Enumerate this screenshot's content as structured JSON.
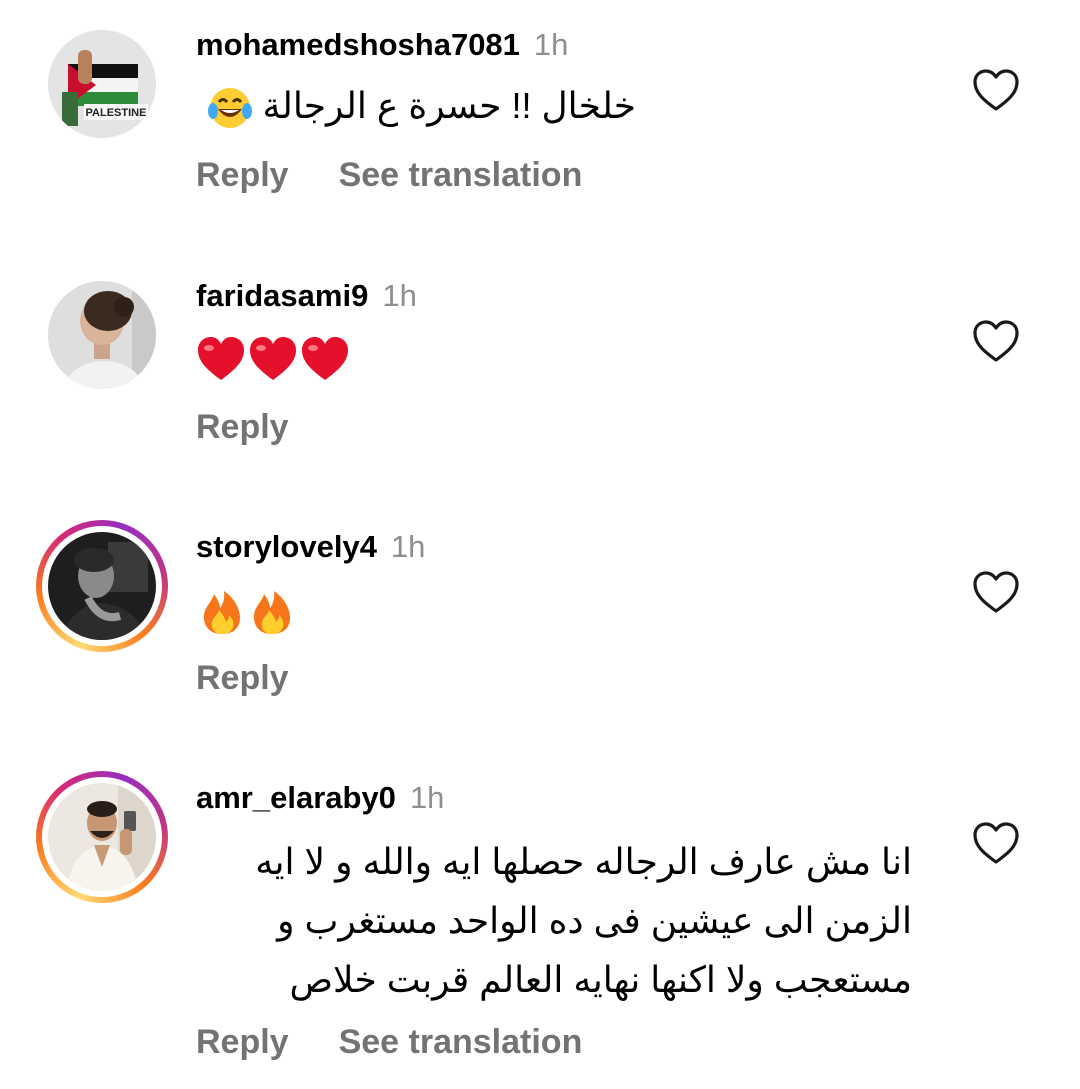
{
  "comments": [
    {
      "username": "mohamedshosha7081",
      "time": "1h",
      "text": "خلخال !! حسرة ع الرجالة",
      "emoji": "laughing-with-tears",
      "reply_label": "Reply",
      "translate_label": "See translation",
      "avatar_caption": "PALESTINE",
      "avatar_ring": false
    },
    {
      "username": "faridasami9",
      "time": "1h",
      "emojis": [
        "red-heart",
        "red-heart",
        "red-heart"
      ],
      "reply_label": "Reply",
      "avatar_ring": false
    },
    {
      "username": "storylovely4",
      "time": "1h",
      "emojis": [
        "fire",
        "fire"
      ],
      "reply_label": "Reply",
      "avatar_ring": true
    },
    {
      "username": "amr_elaraby0",
      "time": "1h",
      "text_lines": [
        "انا مش عارف الرجاله حصلها ايه والله و لا ايه",
        "الزمن الى عيشين فى ده الواحد مستغرب و",
        "مستعجب ولا اكنها نهايه العالم قربت خلاص"
      ],
      "reply_label": "Reply",
      "translate_label": "See translation",
      "avatar_ring": true
    }
  ],
  "like_icon": "heart-outline-icon",
  "colors": {
    "text_primary": "#000000",
    "text_secondary": "#8e8e8e",
    "action_text": "#737373",
    "ring_gradient": [
      "#feda75",
      "#fa7e1e",
      "#d62976",
      "#962fbf"
    ]
  }
}
